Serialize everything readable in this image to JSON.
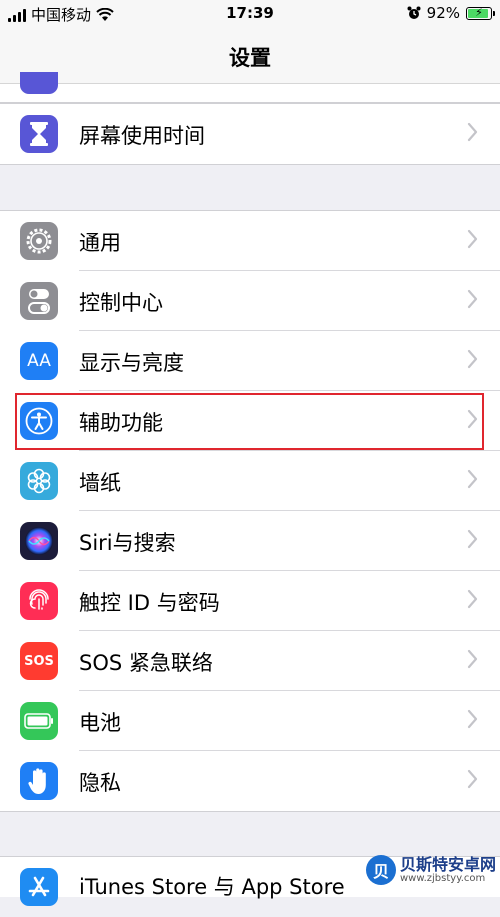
{
  "status": {
    "carrier": "中国移动",
    "time": "17:39",
    "battery": "92%",
    "battery_level": 0.92
  },
  "nav": {
    "title": "设置"
  },
  "rows": [
    {
      "label": "屏幕使用时间",
      "icon": "hourglass-icon",
      "color": "#5856d6"
    },
    {
      "label": "通用",
      "icon": "gear-icon",
      "color": "#8e8e93"
    },
    {
      "label": "控制中心",
      "icon": "toggle-switch-icon",
      "color": "#8e8e93"
    },
    {
      "label": "显示与亮度",
      "icon": "text-size-icon",
      "color": "#1f7ff5",
      "glyph": "AA"
    },
    {
      "label": "辅助功能",
      "icon": "accessibility-icon",
      "color": "#1f7ff5"
    },
    {
      "label": "墙纸",
      "icon": "flower-icon",
      "color": "#36aadc"
    },
    {
      "label": "Siri与搜索",
      "icon": "siri-icon",
      "color": "#1c1c3a"
    },
    {
      "label": "触控 ID 与密码",
      "icon": "fingerprint-icon",
      "color": "#ff2d55"
    },
    {
      "label": "SOS 紧急联络",
      "icon": "sos-icon",
      "color": "#ff3b30",
      "glyph": "SOS"
    },
    {
      "label": "电池",
      "icon": "battery-icon",
      "color": "#34c759"
    },
    {
      "label": "隐私",
      "icon": "hand-icon",
      "color": "#1f7ff5"
    },
    {
      "label": "iTunes Store 与 App Store",
      "icon": "app-store-icon",
      "color": "#1f8cf2"
    }
  ],
  "watermark": {
    "logo": "贝",
    "name": "贝斯特安卓网",
    "url": "www.zjbstyy.com"
  }
}
